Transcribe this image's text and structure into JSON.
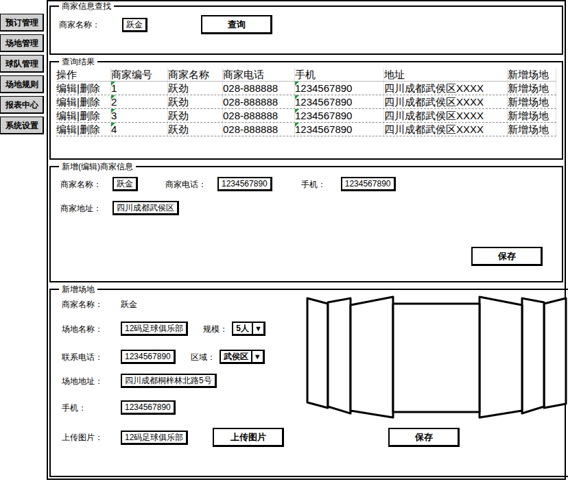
{
  "sidebar": {
    "items": [
      {
        "label": "预订管理"
      },
      {
        "label": "场地管理"
      },
      {
        "label": "球队管理"
      },
      {
        "label": "场地规则"
      },
      {
        "label": "报表中心"
      },
      {
        "label": "系统设置"
      }
    ]
  },
  "search": {
    "legend": "商家信息查找",
    "label": "商家名称：",
    "value": "跃金",
    "button": "查询"
  },
  "results": {
    "legend": "查询结果",
    "columns": [
      {
        "label": "操作",
        "flagged": false
      },
      {
        "label": "商家编号",
        "flagged": true
      },
      {
        "label": "商家名称",
        "flagged": false
      },
      {
        "label": "商家电话",
        "flagged": false
      },
      {
        "label": "手机",
        "flagged": true
      },
      {
        "label": "地址",
        "flagged": false
      },
      {
        "label": "新增场地",
        "flagged": false
      }
    ],
    "rows": [
      [
        "编辑|删除",
        "1",
        "跃劲",
        "028-888888",
        "1234567890",
        "四川成都武侯区XXXX",
        "新增场地"
      ],
      [
        "编辑|删除",
        "2",
        "跃劲",
        "028-888888",
        "1234567890",
        "四川成都武侯区XXXX",
        "新增场地"
      ],
      [
        "编辑|删除",
        "3",
        "跃劲",
        "028-888888",
        "1234567890",
        "四川成都武侯区XXXX",
        "新增场地"
      ],
      [
        "编辑|删除",
        "4",
        "跃劲",
        "028-888888",
        "1234567890",
        "四川成都武侯区XXXX",
        "新增场地"
      ]
    ]
  },
  "merchant_form": {
    "legend": "新增(编辑)商家信息",
    "fields": [
      {
        "label": "商家名称：",
        "value": "跃金"
      },
      {
        "label": "商家电话：",
        "value": "1234567890"
      },
      {
        "label": "手机：",
        "value": "1234567890"
      }
    ],
    "address": {
      "label": "商家地址：",
      "value": "四川成都武侯区"
    },
    "button": "保存"
  },
  "venue_form": {
    "legend": "新增场地",
    "select_arrow": "▼",
    "rows": [
      [
        {
          "label": "商家名称：",
          "value": "跃金",
          "kind": "text"
        }
      ],
      [
        {
          "label": "场地名称：",
          "value": "12码足球俱乐部",
          "kind": "input"
        },
        {
          "label": "规模：",
          "value": "5人",
          "kind": "select"
        }
      ],
      [
        {
          "label": "联系电话：",
          "value": "1234567890",
          "kind": "input"
        },
        {
          "label": "区域：",
          "value": "武侯区",
          "kind": "select"
        }
      ],
      [
        {
          "label": "场地地址：",
          "value": "四川成都桐梓林北路5号",
          "kind": "input"
        }
      ],
      [
        {
          "label": "手机：",
          "value": "1234567890",
          "kind": "input"
        }
      ]
    ],
    "upload": {
      "label": "上传图片：",
      "value": "12码足球俱乐部",
      "button": "上传图片"
    },
    "button": "保存"
  }
}
